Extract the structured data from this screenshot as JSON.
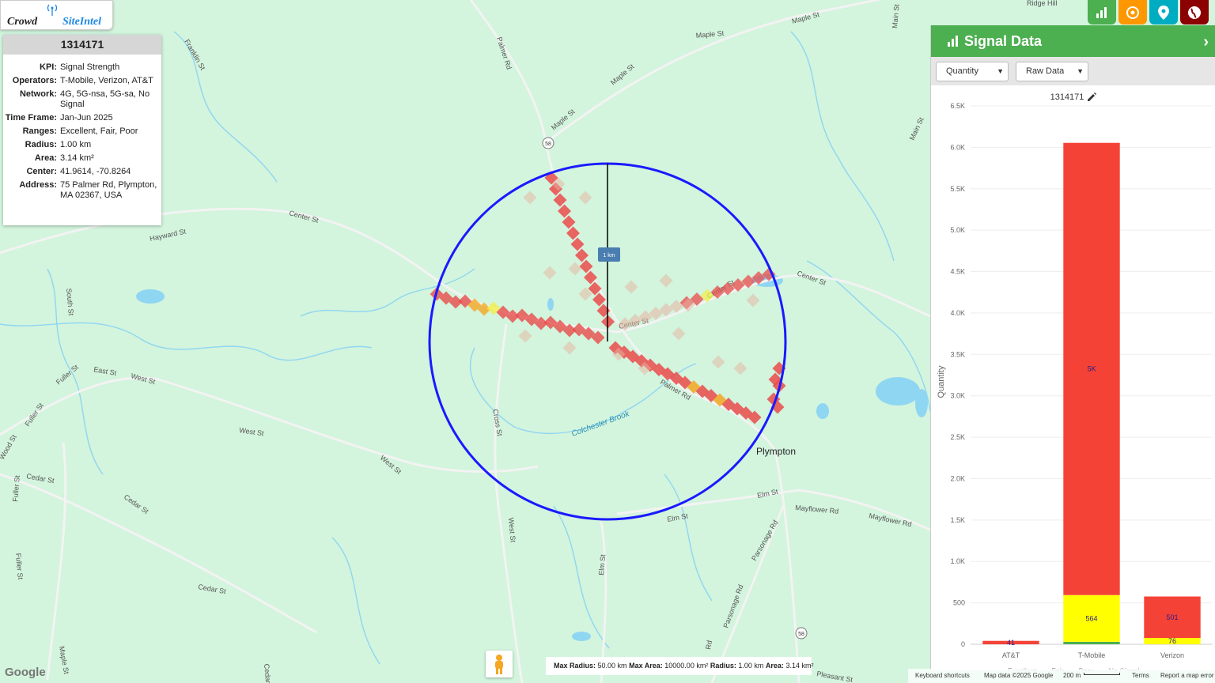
{
  "app": {
    "logo_part1": "Crowd",
    "logo_part2": "SiteIntel"
  },
  "info": {
    "id": "1314171",
    "rows": [
      {
        "k": "KPI:",
        "v": "Signal Strength"
      },
      {
        "k": "Operators:",
        "v": "T-Mobile, Verizon, AT&T"
      },
      {
        "k": "Network:",
        "v": "4G, 5G-nsa, 5G-sa, No Signal"
      },
      {
        "k": "Time Frame:",
        "v": "Jan-Jun 2025"
      },
      {
        "k": "Ranges:",
        "v": "Excellent, Fair, Poor"
      },
      {
        "k": "Radius:",
        "v": "1.00 km"
      },
      {
        "k": "Area:",
        "v": "3.14 km²"
      },
      {
        "k": "Center:",
        "v": "41.9614, -70.8264"
      },
      {
        "k": "Address:",
        "v": "75 Palmer Rd, Plympton, MA 02367, USA"
      }
    ]
  },
  "toolbar": {
    "buttons": [
      {
        "name": "chart-icon",
        "color": "#4caf50"
      },
      {
        "name": "target-icon",
        "color": "#ff9800"
      },
      {
        "name": "location-pin-icon",
        "color": "#00acc1"
      },
      {
        "name": "globe-icon",
        "color": "#8b0000"
      }
    ]
  },
  "panel": {
    "title": "Signal Data",
    "select1": "Quantity",
    "select2": "Raw Data"
  },
  "chart_data": {
    "type": "bar",
    "stacked": true,
    "title": "1314171",
    "ylabel": "Quantity",
    "ylim": [
      0,
      6500
    ],
    "yticks": [
      "0",
      "500",
      "1.0K",
      "1.5K",
      "2.0K",
      "2.5K",
      "3.0K",
      "3.5K",
      "4.0K",
      "4.5K",
      "5.0K",
      "5.5K",
      "6.0K",
      "6.5K"
    ],
    "categories": [
      "AT&T",
      "T-Mobile",
      "Verizon"
    ],
    "series": [
      {
        "name": "Excellent",
        "color": "#4caf50",
        "values": [
          0,
          30,
          0
        ]
      },
      {
        "name": "Fair",
        "color": "#ffff00",
        "values": [
          0,
          564,
          76
        ]
      },
      {
        "name": "Poor",
        "color": "#f44336",
        "values": [
          41,
          5460,
          501
        ]
      },
      {
        "name": "No Signal",
        "color": "#c8c8c8",
        "values": [
          0,
          0,
          0
        ]
      }
    ],
    "data_labels": [
      {
        "category": "AT&T",
        "series": "Poor",
        "text": "41"
      },
      {
        "category": "T-Mobile",
        "series": "Fair",
        "text": "564"
      },
      {
        "category": "T-Mobile",
        "series": "Poor",
        "text": "5K"
      },
      {
        "category": "Verizon",
        "series": "Fair",
        "text": "76"
      },
      {
        "category": "Verizon",
        "series": "Poor",
        "text": "501"
      }
    ],
    "legend_position": "bottom"
  },
  "map": {
    "labels": [
      "Palmer Rd",
      "Maple St",
      "Maple St",
      "Maple St",
      "Maple St",
      "Main St",
      "Main St",
      "Franklin St",
      "Center St",
      "Center St",
      "Center St",
      "Center St",
      "Hayward St",
      "South St",
      "East St",
      "West St",
      "West St",
      "West St",
      "West St",
      "Fuller St",
      "Fuller St",
      "Fuller St",
      "Fuller St",
      "Cedar St",
      "Cedar St",
      "Cedar St",
      "Cross St",
      "Elm St",
      "Elm St",
      "Elm St",
      "Mayflower Rd",
      "Mayflower Rd",
      "Parsonage Rd",
      "Parsonage Rd",
      "Pleasant St",
      "Wood St",
      "Ridge Hill",
      "58",
      "58",
      "Colchester Brook",
      "Plympton",
      "Main St",
      "Palmer Rd",
      "Cedar",
      "Rd"
    ],
    "scale_label": "1 km"
  },
  "footer": {
    "max_radius_k": "Max Radius:",
    "max_radius_v": "50.00 km",
    "max_area_k": "Max Area:",
    "max_area_v": "10000.00 km²",
    "radius_k": "Radius:",
    "radius_v": "1.00 km",
    "area_k": "Area:",
    "area_v": "3.14 km²",
    "shortcuts": "Keyboard shortcuts",
    "mapdata": "Map data ©2025 Google",
    "scale": "200 m",
    "terms": "Terms",
    "report": "Report a map error",
    "google": "Google"
  }
}
